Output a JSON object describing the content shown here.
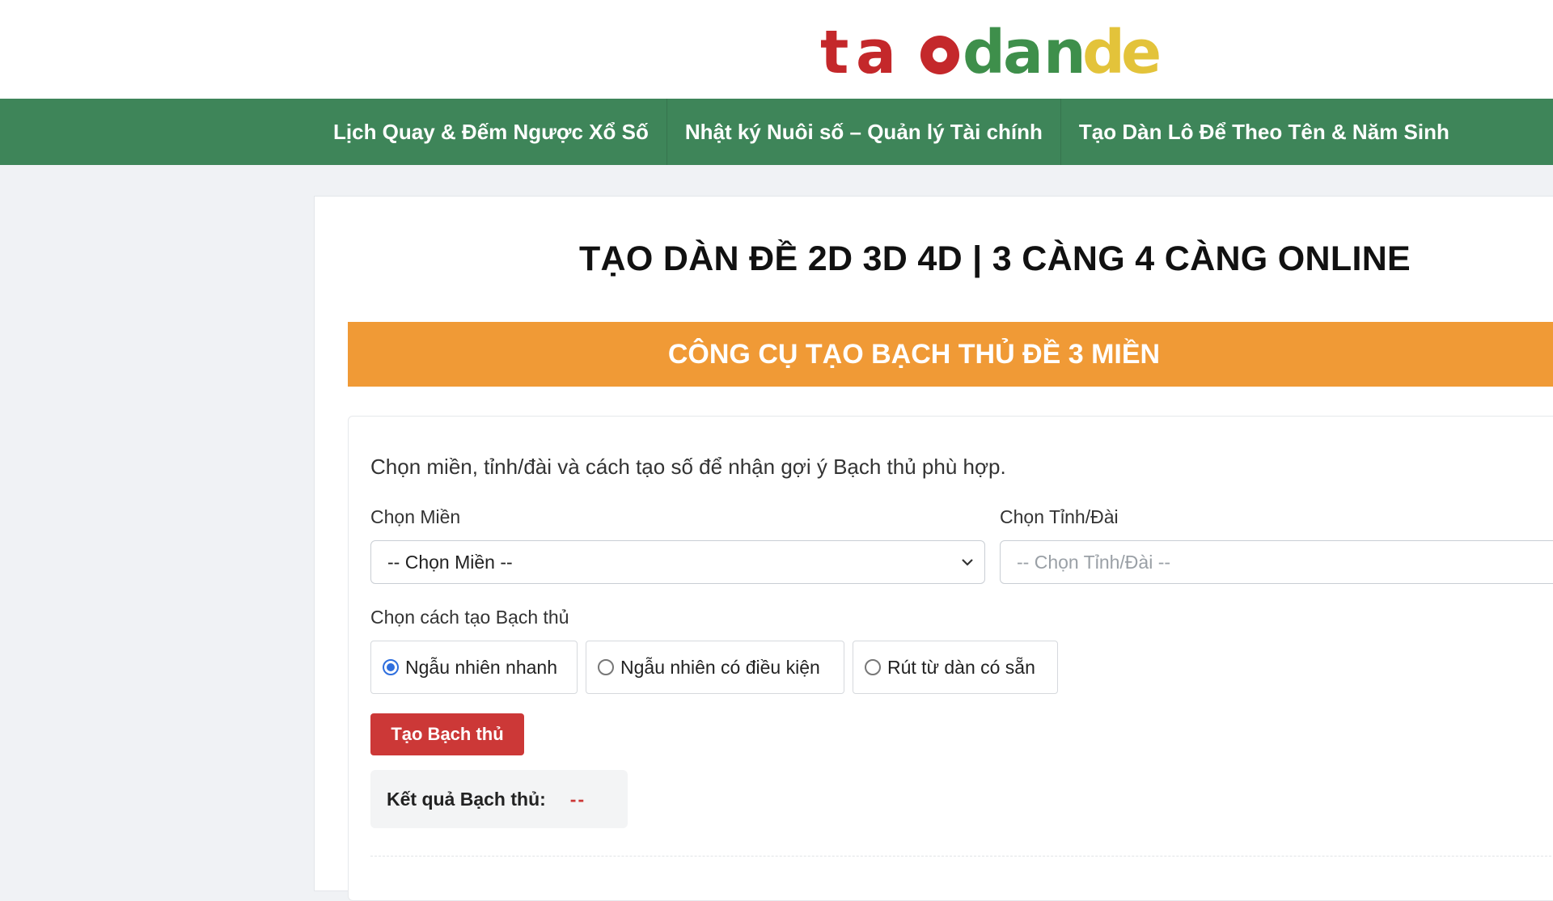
{
  "logo": {
    "text": "taodande"
  },
  "nav": {
    "items": [
      {
        "label": "Lịch Quay & Đếm Ngược Xổ Số"
      },
      {
        "label": "Nhật ký Nuôi số – Quản lý Tài chính"
      },
      {
        "label": "Tạo Dàn Lô Để Theo Tên & Năm Sinh"
      }
    ]
  },
  "page": {
    "title": "TẠO DÀN ĐỀ 2D 3D 4D | 3 CÀNG 4 CÀNG ONLINE",
    "banner": "CÔNG CỤ TẠO BẠCH THỦ ĐỀ 3 MIỀN"
  },
  "form": {
    "intro": "Chọn miền, tỉnh/đài và cách tạo số để nhận gợi ý Bạch thủ phù hợp.",
    "region_label": "Chọn Miền",
    "region_value": "-- Chọn Miền --",
    "province_label": "Chọn Tỉnh/Đài",
    "province_value": "-- Chọn Tỉnh/Đài --",
    "method_label": "Chọn cách tạo Bạch thủ",
    "methods": [
      {
        "label": "Ngẫu nhiên nhanh",
        "checked": true
      },
      {
        "label": "Ngẫu nhiên có điều kiện",
        "checked": false
      },
      {
        "label": "Rút từ dàn có sẵn",
        "checked": false
      }
    ],
    "submit_label": "Tạo Bạch thủ",
    "result_label": "Kết quả Bạch thủ:",
    "result_value": "--"
  },
  "colors": {
    "nav_bg": "#3e8559",
    "banner_bg": "#f09a36",
    "button_bg": "#cc3837",
    "radio_accent": "#2f6fde"
  }
}
